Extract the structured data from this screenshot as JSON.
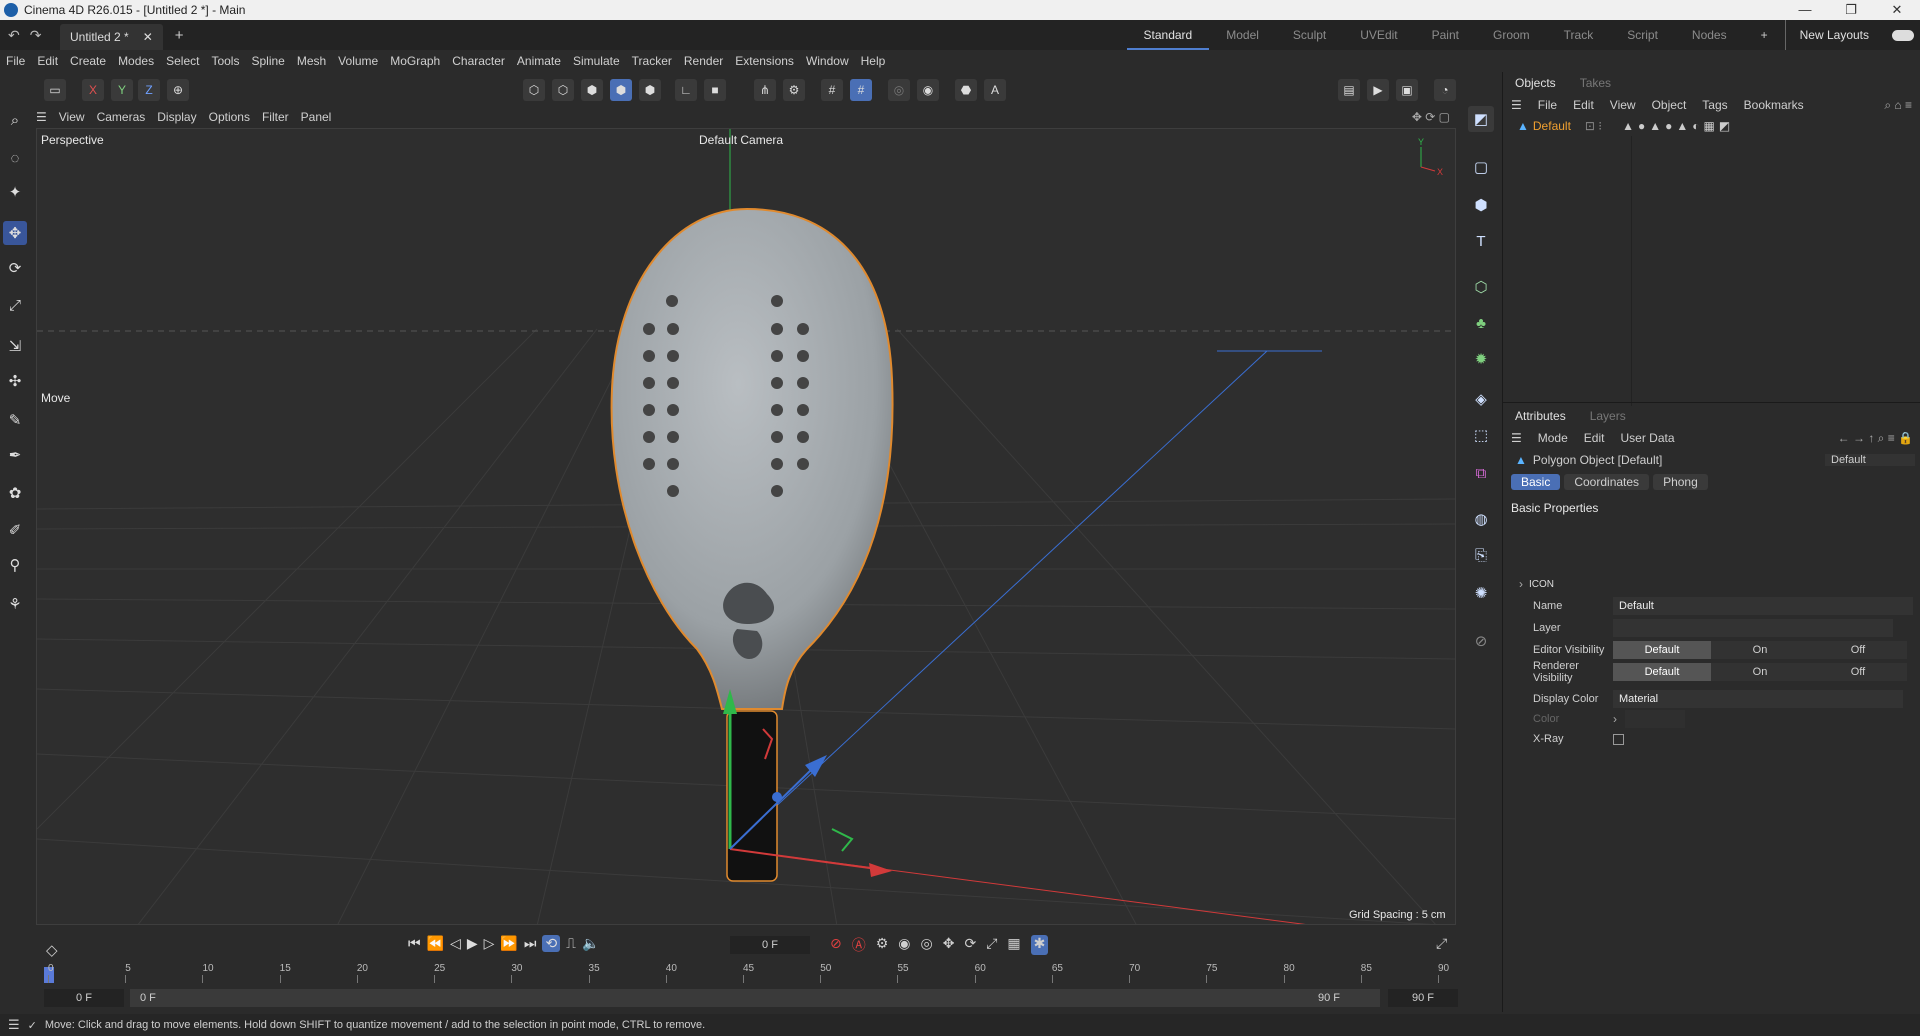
{
  "window": {
    "title": "Cinema 4D R26.015 - [Untitled 2 *] - Main",
    "min": "—",
    "max": "❐",
    "close": "✕"
  },
  "tabs": {
    "doc_tab": "Untitled 2 *",
    "close": "✕",
    "new": "+"
  },
  "layouts": [
    "Standard",
    "Model",
    "Sculpt",
    "UVEdit",
    "Paint",
    "Groom",
    "Track",
    "Script",
    "Nodes"
  ],
  "layouts_plus": "+",
  "new_layouts": "New Layouts",
  "menu": [
    "File",
    "Edit",
    "Create",
    "Modes",
    "Select",
    "Tools",
    "Spline",
    "Mesh",
    "Volume",
    "MoGraph",
    "Character",
    "Animate",
    "Simulate",
    "Tracker",
    "Render",
    "Extensions",
    "Window",
    "Help"
  ],
  "axis_lock": [
    "X",
    "Y",
    "Z"
  ],
  "viewport": {
    "menu": [
      "View",
      "Cameras",
      "Display",
      "Options",
      "Filter",
      "Panel"
    ],
    "label": "Perspective",
    "camera": "Default Camera",
    "tool": "Move",
    "grid_spacing": "Grid Spacing : 5 cm"
  },
  "objects": {
    "tabs": [
      "Objects",
      "Takes"
    ],
    "menu": [
      "File",
      "Edit",
      "View",
      "Object",
      "Tags",
      "Bookmarks"
    ],
    "item": "Default"
  },
  "attributes": {
    "tabs": [
      "Attributes",
      "Layers"
    ],
    "menu": [
      "Mode",
      "Edit",
      "User Data"
    ],
    "object_title": "Polygon Object [Default]",
    "mode_select": "Default",
    "subtabs": [
      "Basic",
      "Coordinates",
      "Phong"
    ],
    "section": "Basic Properties",
    "icon_label": "ICON",
    "name_label": "Name",
    "name_value": "Default",
    "layer_label": "Layer",
    "editor_vis_label": "Editor Visibility",
    "render_vis_label": "Renderer Visibility",
    "vis_options": [
      "Default",
      "On",
      "Off"
    ],
    "display_color_label": "Display Color",
    "display_color_value": "Material",
    "color_label": "Color",
    "xray_label": "X-Ray"
  },
  "timeline": {
    "frame": "0 F",
    "ticks": [
      "0",
      "5",
      "10",
      "15",
      "20",
      "25",
      "30",
      "35",
      "40",
      "45",
      "50",
      "55",
      "60",
      "65",
      "70",
      "75",
      "80",
      "85",
      "90"
    ],
    "start1": "0 F",
    "start2": "0 F",
    "end1": "90 F",
    "end2": "90 F"
  },
  "status": "Move: Click and drag to move elements. Hold down SHIFT to quantize movement / add to the selection in point mode, CTRL to remove.",
  "colors": {
    "accent": "#4a6fb5",
    "selection": "#e08a2e",
    "x_axis": "#d23a3a",
    "y_axis": "#2fb84a",
    "z_axis": "#3a6ed2"
  }
}
